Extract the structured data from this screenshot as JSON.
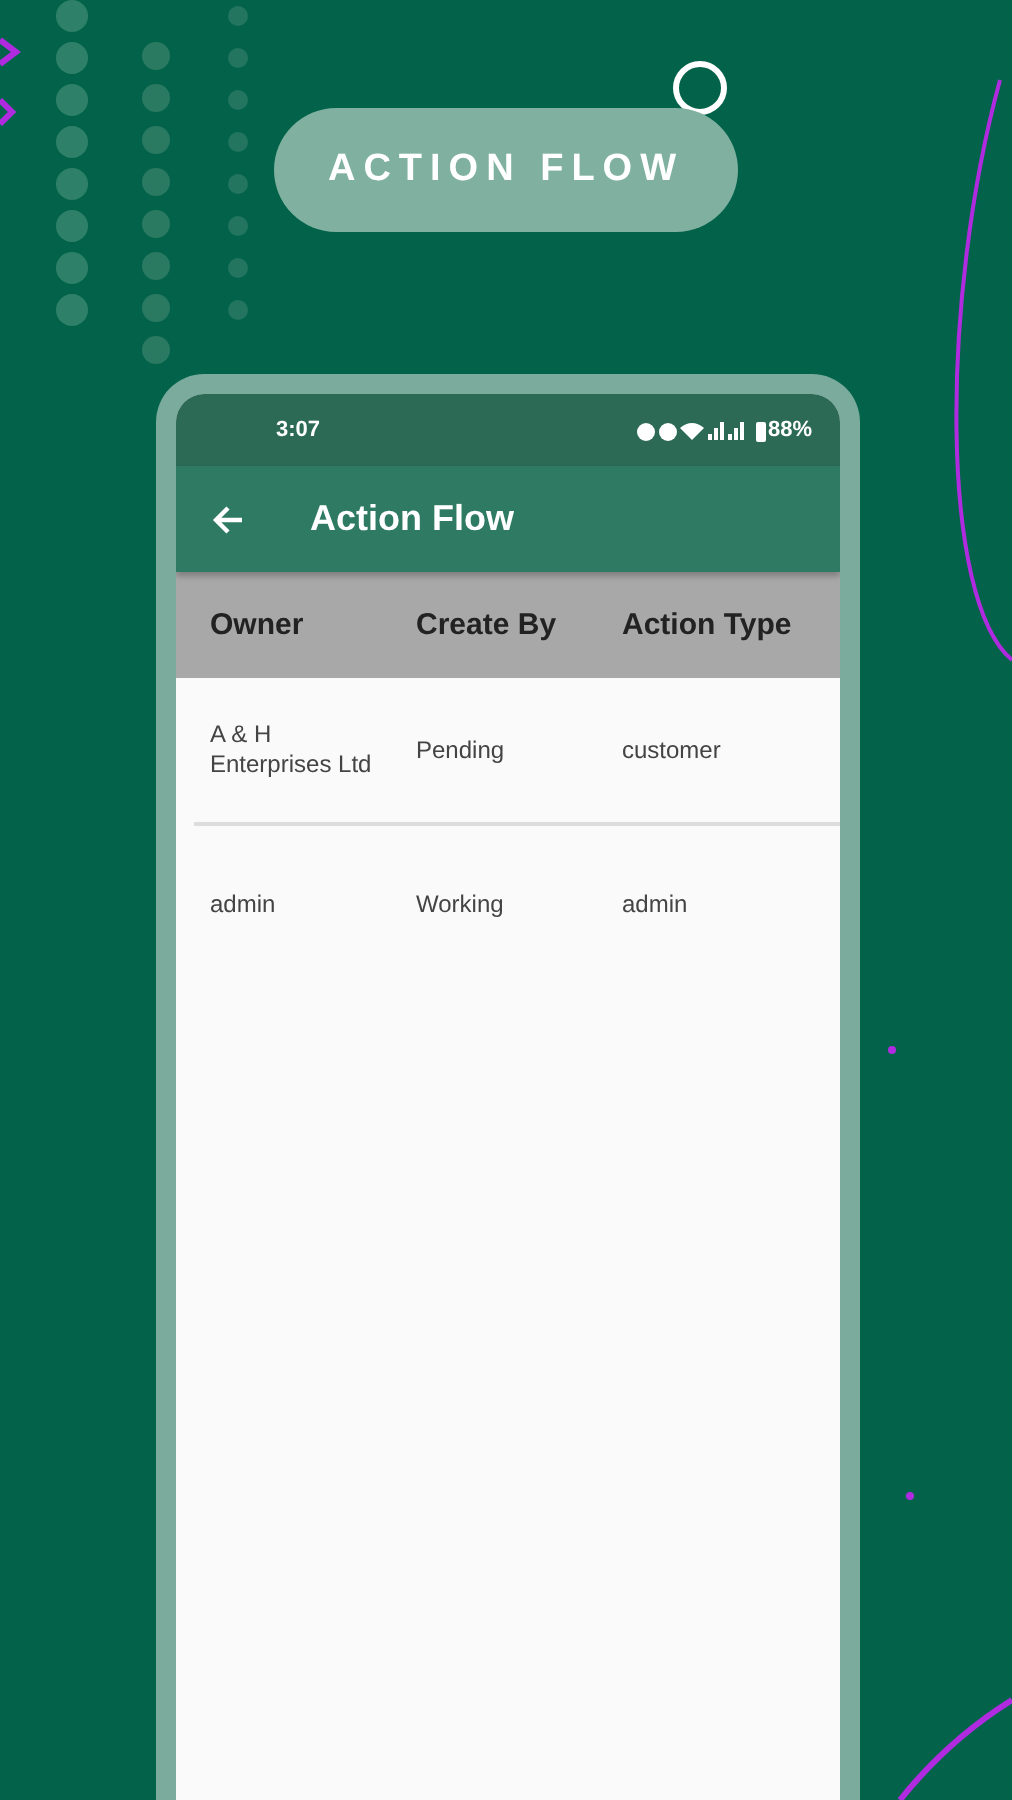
{
  "banner": {
    "title": "ACTION FLOW"
  },
  "status_bar": {
    "time": "3:07",
    "battery": "88%"
  },
  "app_bar": {
    "title": "Action Flow"
  },
  "table": {
    "columns": [
      "Owner",
      "Create By",
      "Action Type"
    ],
    "rows": [
      [
        "A & H Enterprises Ltd",
        "Pending",
        "customer"
      ],
      [
        "admin",
        "Working",
        "admin"
      ]
    ]
  }
}
